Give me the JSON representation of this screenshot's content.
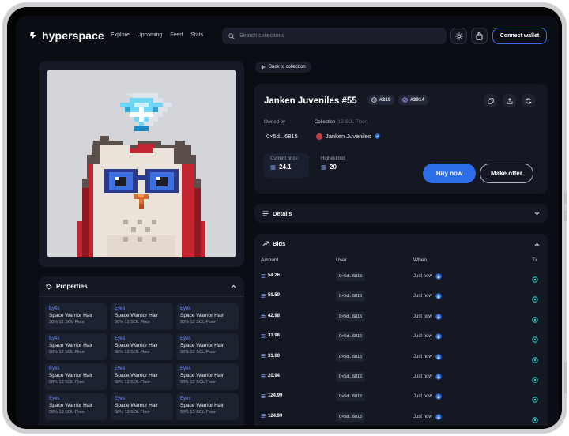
{
  "brand": {
    "name": "hyperspace"
  },
  "nav": {
    "links": [
      "Explore",
      "Upcoming",
      "Feed",
      "Stats"
    ]
  },
  "search": {
    "placeholder": "Search collections"
  },
  "header": {
    "connect_label": "Connect wallet"
  },
  "back": {
    "label": "Back to collection"
  },
  "nft": {
    "title": "Janken Juveniles #55",
    "rank_a": "#319",
    "rank_b": "#3914",
    "owned_by_label": "Owned by",
    "owner": "0×5d...6815",
    "collection_label": "Collection",
    "collection_floor": "(12 SOL Floor)",
    "collection_name": "Janken Juveniles",
    "current_price_label": "Current price",
    "current_price": "24.1",
    "highest_bid_label": "Highest bid",
    "highest_bid": "20",
    "buy_label": "Buy now",
    "offer_label": "Make offer"
  },
  "properties": {
    "title": "Properties",
    "items": [
      {
        "type": "Eyes",
        "value": "Space Warrior Hair",
        "sub": "98% 12 SOL Floor"
      },
      {
        "type": "Eyes",
        "value": "Space Warrior Hair",
        "sub": "98% 12 SOL Floor"
      },
      {
        "type": "Eyes",
        "value": "Space Warrior Hair",
        "sub": "98% 12 SOL Floor"
      },
      {
        "type": "Eyes",
        "value": "Space Warrior Hair",
        "sub": "98% 12 SOL Floor"
      },
      {
        "type": "Eyes",
        "value": "Space Warrior Hair",
        "sub": "98% 12 SOL Floor"
      },
      {
        "type": "Eyes",
        "value": "Space Warrior Hair",
        "sub": "98% 12 SOL Floor"
      },
      {
        "type": "Eyes",
        "value": "Space Warrior Hair",
        "sub": "98% 12 SOL Floor"
      },
      {
        "type": "Eyes",
        "value": "Space Warrior Hair",
        "sub": "98% 12 SOL Floor"
      },
      {
        "type": "Eyes",
        "value": "Space Warrior Hair",
        "sub": "98% 12 SOL Floor"
      },
      {
        "type": "Eyes",
        "value": "Space Warrior Hair",
        "sub": "98% 12 SOL Floor"
      },
      {
        "type": "Eyes",
        "value": "Space Warrior Hair",
        "sub": "98% 12 SOL Floor"
      },
      {
        "type": "Eyes",
        "value": "Space Warrior Hair",
        "sub": "98% 12 SOL Floor"
      }
    ]
  },
  "details": {
    "title": "Details"
  },
  "bids": {
    "title": "Bids",
    "columns": [
      "Amount",
      "User",
      "When",
      "Tx"
    ],
    "rows": [
      {
        "amount": "54.26",
        "user": "0×5d...6815",
        "when": "Just now"
      },
      {
        "amount": "50.59",
        "user": "0×5d...6815",
        "when": "Just now"
      },
      {
        "amount": "42.98",
        "user": "0×5d...6815",
        "when": "Just now"
      },
      {
        "amount": "31.98",
        "user": "0×5d...6815",
        "when": "Just now"
      },
      {
        "amount": "31.60",
        "user": "0×5d...6815",
        "when": "Just now"
      },
      {
        "amount": "20.94",
        "user": "0×5d...6815",
        "when": "Just now"
      },
      {
        "amount": "124.99",
        "user": "0×5d...6815",
        "when": "Just now"
      },
      {
        "amount": "124.99",
        "user": "0×5d...6815",
        "when": "Just now"
      }
    ]
  },
  "colors": {
    "accent": "#2c6de8",
    "background": "#0b0d15",
    "card": "#141823",
    "tx_icon": "#27c9c9"
  },
  "icons": [
    "lightning-logo-icon",
    "search-icon",
    "sun-icon",
    "bag-icon",
    "arrow-left-icon",
    "copy-icon",
    "share-icon",
    "refresh-icon",
    "verified-icon",
    "tag-icon",
    "list-icon",
    "trend-icon",
    "chevron-icon",
    "solana-icon",
    "wallet-icon",
    "tx-link-icon"
  ]
}
